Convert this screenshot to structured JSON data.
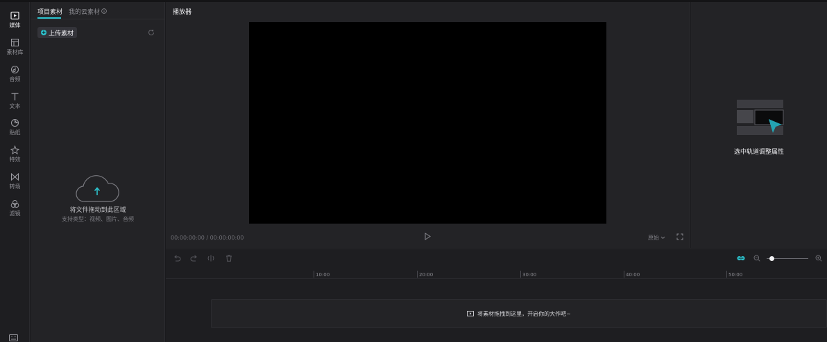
{
  "rail": {
    "items": [
      {
        "label": "媒体",
        "icon": "media-icon",
        "active": true
      },
      {
        "label": "素材库",
        "icon": "library-icon"
      },
      {
        "label": "音频",
        "icon": "audio-icon"
      },
      {
        "label": "文本",
        "icon": "text-icon"
      },
      {
        "label": "贴纸",
        "icon": "sticker-icon"
      },
      {
        "label": "特效",
        "icon": "effects-icon"
      },
      {
        "label": "转场",
        "icon": "transition-icon"
      },
      {
        "label": "滤镜",
        "icon": "filter-icon"
      }
    ],
    "bottom_icon": "keyboard-icon"
  },
  "media": {
    "tabs": [
      {
        "label": "项目素材",
        "active": true
      },
      {
        "label": "我的云素材"
      }
    ],
    "upload_label": "上传素材",
    "drop_title": "将文件拖动到此区域",
    "drop_subtitle": "支持类型：视频、图片、音频"
  },
  "player": {
    "title": "播放器",
    "timecode": "00:00:00:00 / 00:00:00:00",
    "ratio": "原始"
  },
  "properties": {
    "empty_text": "选中轨道调整属性"
  },
  "timeline": {
    "ruler_labels": [
      "10:00",
      "20:00",
      "30:00",
      "40:00",
      "50:00"
    ],
    "track_hint": "将素材拖拽到这里，开启你的大作吧~",
    "zoom_level": 0.12
  },
  "colors": {
    "accent": "#2dc4cf",
    "background": "#1a1a1d",
    "panel": "#232326"
  }
}
